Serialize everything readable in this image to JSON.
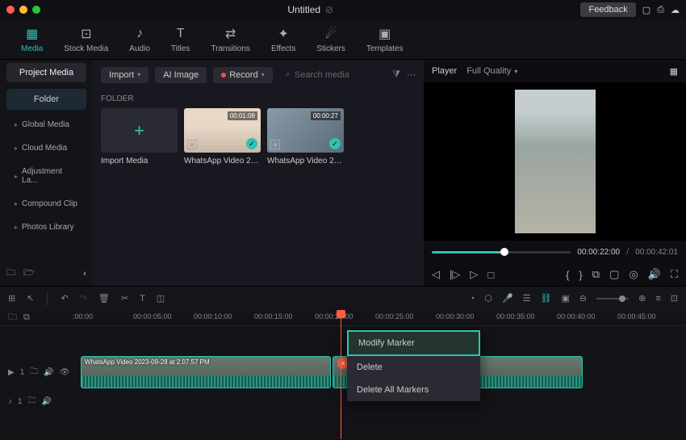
{
  "title": "Untitled",
  "titlebar": {
    "feedback": "Feedback"
  },
  "main_tabs": [
    {
      "label": "Media",
      "icon": "▦"
    },
    {
      "label": "Stock Media",
      "icon": "⊡"
    },
    {
      "label": "Audio",
      "icon": "♪"
    },
    {
      "label": "Titles",
      "icon": "T"
    },
    {
      "label": "Transitions",
      "icon": "⇄"
    },
    {
      "label": "Effects",
      "icon": "✦"
    },
    {
      "label": "Stickers",
      "icon": "☄"
    },
    {
      "label": "Templates",
      "icon": "▣"
    }
  ],
  "sidebar": {
    "project": "Project Media",
    "folder": "Folder",
    "items": [
      "Global Media",
      "Cloud Media",
      "Adjustment La...",
      "Compound Clip",
      "Photos Library"
    ]
  },
  "content_toolbar": {
    "import": "Import",
    "ai_image": "AI Image",
    "record": "Record",
    "search_placeholder": "Search media"
  },
  "folder_label": "FOLDER",
  "media": {
    "import_label": "Import Media",
    "items": [
      {
        "name": "WhatsApp Video 202...",
        "duration": "00:01:09"
      },
      {
        "name": "WhatsApp Video 202...",
        "duration": "00:00:27"
      }
    ]
  },
  "player": {
    "tab": "Player",
    "quality": "Full Quality",
    "current": "00:00:22:00",
    "total": "00:00:42:01"
  },
  "ruler_ticks": [
    ":00:00",
    "00:00:05:00",
    "00:00:10:00",
    "00:00:15:00",
    "00:00:20:00",
    "00:00:25:00",
    "00:00:30:00",
    "00:00:35:00",
    "00:00:40:00",
    "00:00:45:00"
  ],
  "context": {
    "modify": "Modify Marker",
    "delete": "Delete",
    "delete_all": "Delete All Markers"
  },
  "clip_label": "WhatsApp Video 2023-09-28 at 2.07.57 PM",
  "tracks": {
    "video": "1",
    "audio": "1"
  }
}
